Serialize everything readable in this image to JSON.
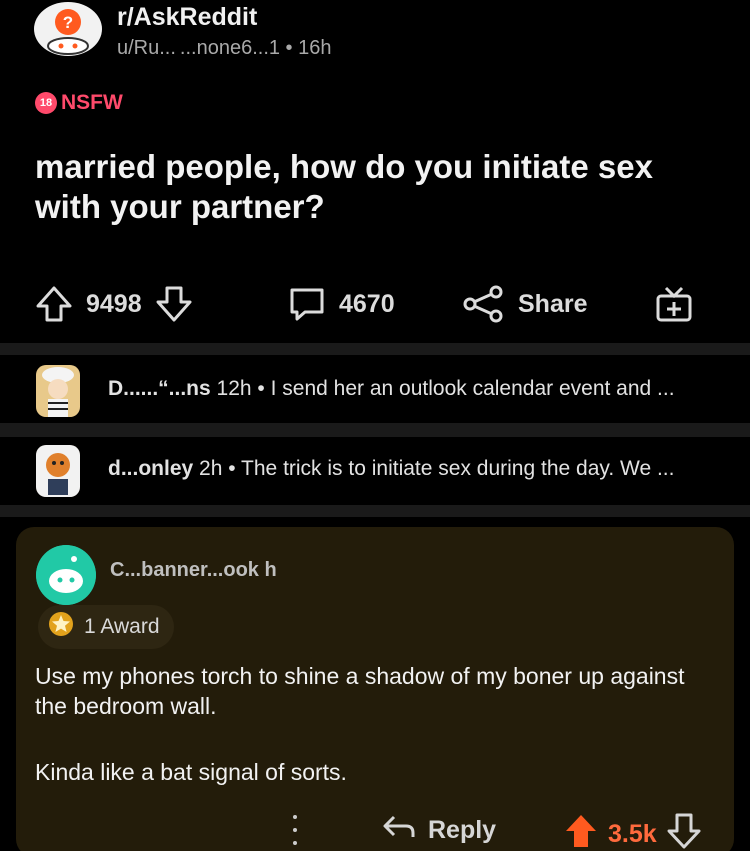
{
  "post": {
    "subreddit": "r/AskReddit",
    "author_meta": "u/Ru... ...none6...1 • 16h",
    "nsfw_count": "18",
    "nsfw_label": "NSFW",
    "title": "married people, how do you initiate sex with your partner?",
    "upvotes": "9498",
    "comments": "4670",
    "share_label": "Share"
  },
  "previews": [
    {
      "user": "D......“...ns",
      "time": "12h",
      "text": "I send her an outlook calendar event and ..."
    },
    {
      "user": "d...onley",
      "time": "2h",
      "text": "The trick is to initiate sex during the day. We ..."
    }
  ],
  "comment": {
    "user": "C...banner...ook",
    "time": "h",
    "award": "1 Award",
    "paragraphs": [
      "Use my phones torch to shine a shadow of my boner up against the bedroom wall.",
      "Kinda like a bat signal of sorts."
    ],
    "reply_label": "Reply",
    "votes": "3.5k"
  },
  "colors": {
    "nsfw": "#ff4a6b",
    "upvote_active": "#ff6a3d",
    "comment_bg": "#231c0a",
    "avatar_teal": "#21c9a6"
  },
  "icons": [
    "upvote-icon",
    "downvote-icon",
    "comment-icon",
    "share-icon",
    "award-gift-icon",
    "reply-icon",
    "more-icon",
    "star-award-icon"
  ]
}
